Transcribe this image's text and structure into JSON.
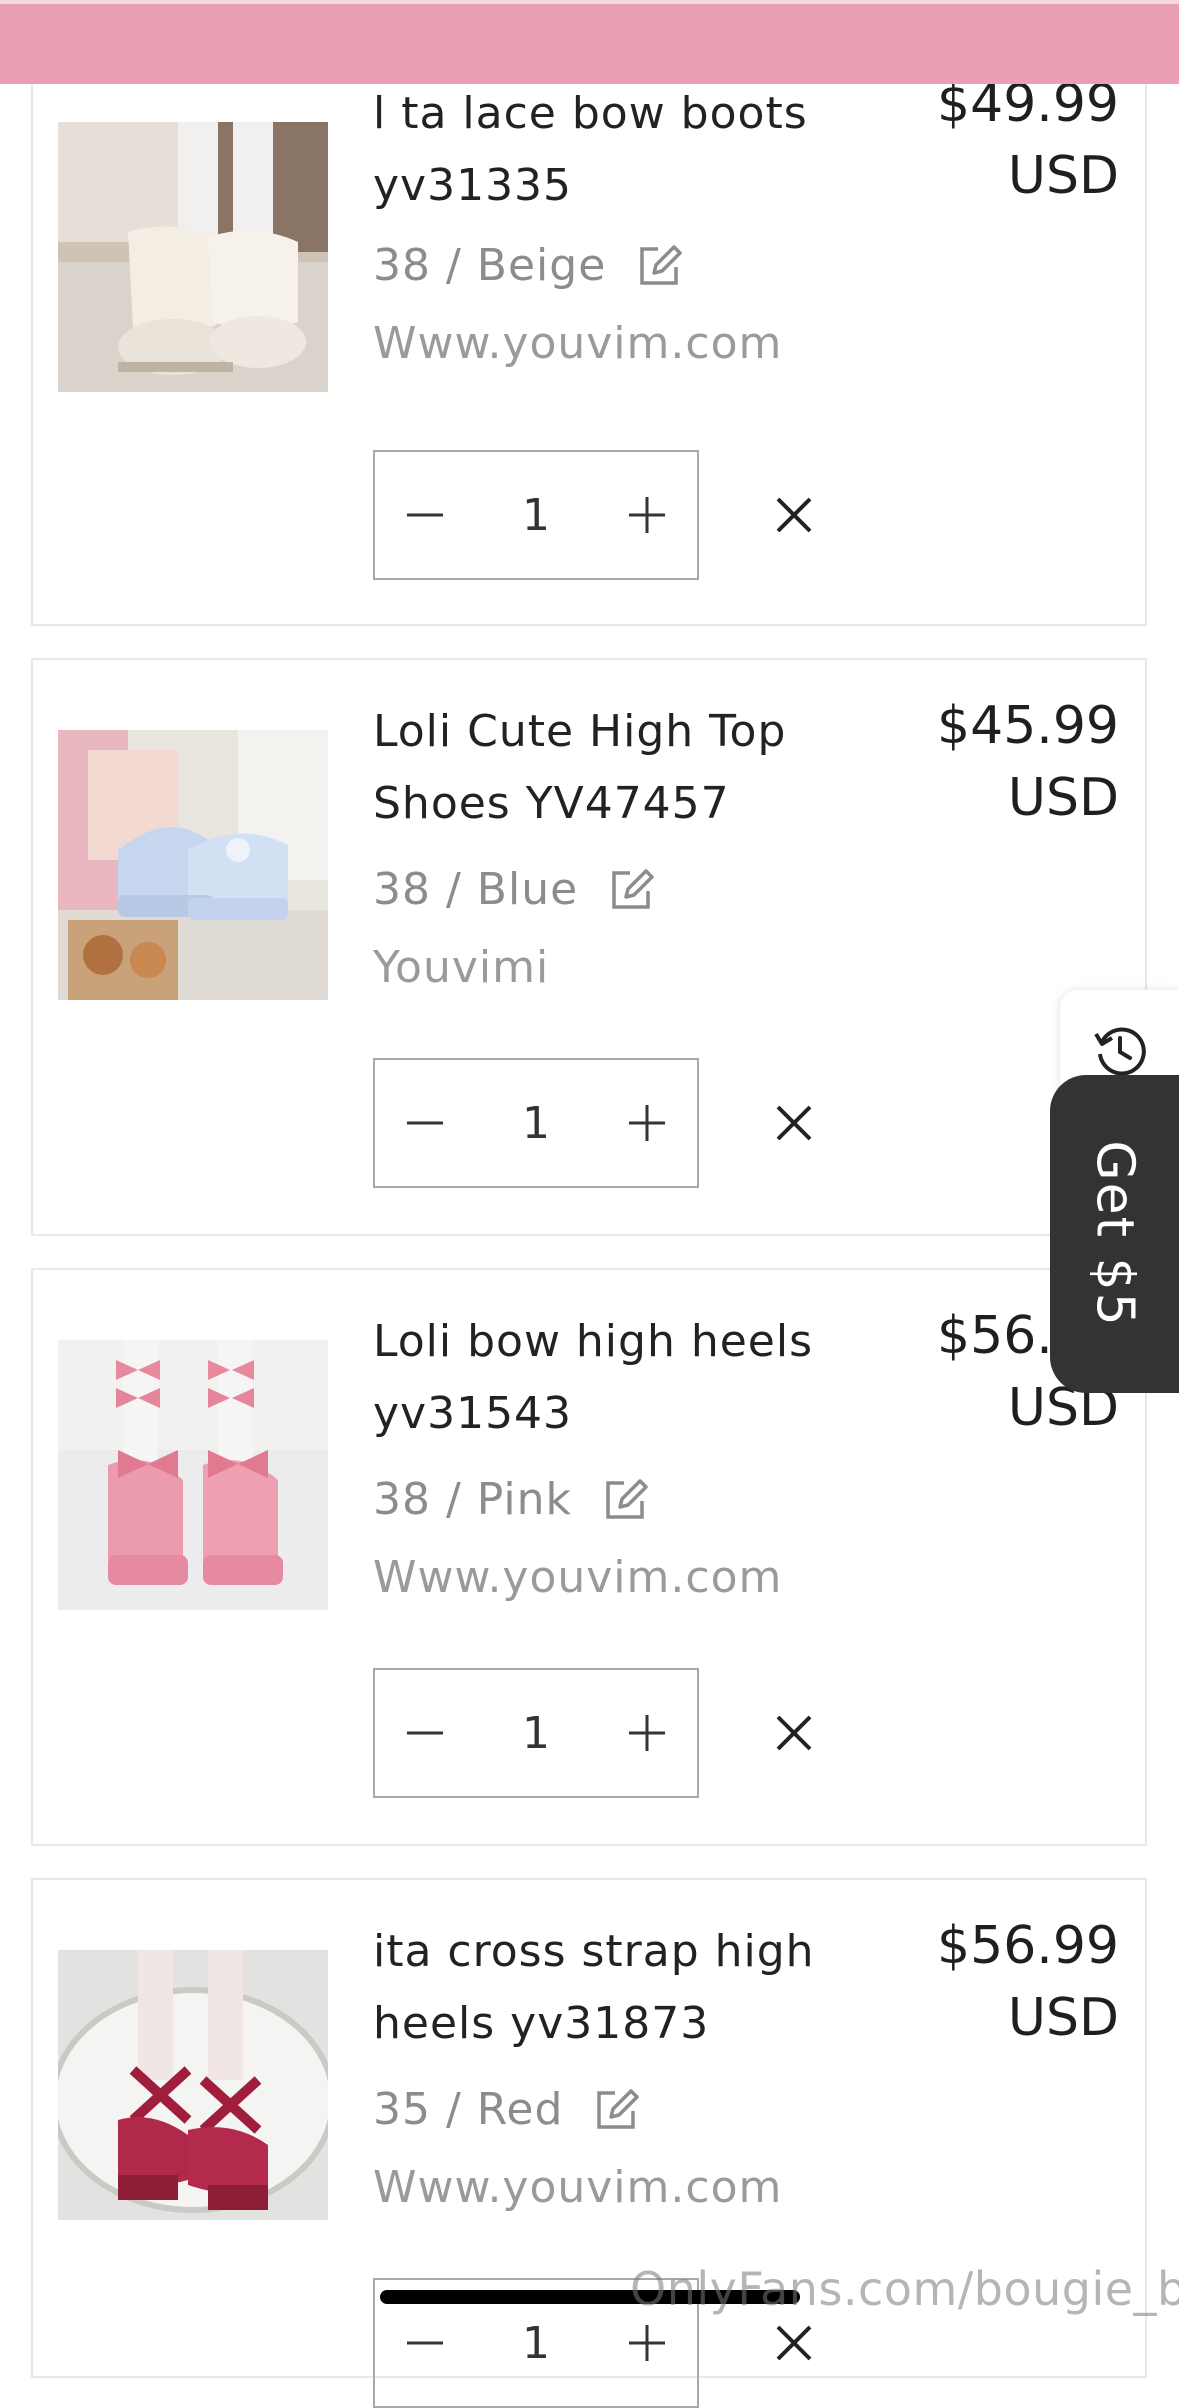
{
  "items": [
    {
      "title": "l   ta lace bow boots yv31335",
      "price": "$49.99",
      "currency": "USD",
      "variant": "38 / Beige",
      "vendor": "Www.youvim.com",
      "quantity": "1",
      "image_icon": "lace-bow-boots-photo"
    },
    {
      "title": "Loli   Cute High Top Shoes YV47457",
      "price": "$45.99",
      "currency": "USD",
      "variant": "38 / Blue",
      "vendor": "Youvimi",
      "quantity": "1",
      "image_icon": "blue-high-top-shoes-photo"
    },
    {
      "title": "Loli   bow high heels yv31543",
      "price": "$56.99",
      "currency": "USD",
      "variant": "38 / Pink",
      "vendor": "Www.youvim.com",
      "quantity": "1",
      "image_icon": "pink-bow-heels-photo"
    },
    {
      "title": "   ita cross strap high heels yv31873",
      "price": "$56.99",
      "currency": "USD",
      "variant": "35 / Red",
      "vendor": "Www.youvim.com",
      "quantity": "1",
      "image_icon": "red-cross-strap-heels-photo"
    }
  ],
  "side_tabs": {
    "history_icon": "history-clock-icon",
    "reward_label": "Get $5"
  },
  "watermark": "OnlyFans.com/bougie_bb",
  "colors": {
    "topbar": "#e8a0b2",
    "reward_tab": "#333333"
  }
}
